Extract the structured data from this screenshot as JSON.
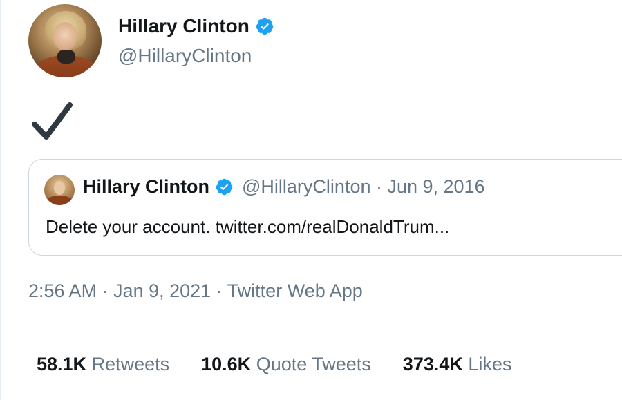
{
  "tweet": {
    "author": {
      "display_name": "Hillary Clinton",
      "handle": "@HillaryClinton",
      "verified_icon": "verified-badge-icon"
    },
    "body": {
      "icon": "check-mark-icon"
    },
    "quoted_tweet": {
      "display_name": "Hillary Clinton",
      "handle_and_date": "@HillaryClinton · Jun 9, 2016",
      "text": "Delete your account. twitter.com/realDonaldTrum..."
    },
    "timestamp": "2:56 AM · Jan 9, 2021 · Twitter Web App",
    "stats": [
      {
        "count": "58.1K",
        "label": "Retweets"
      },
      {
        "count": "10.6K",
        "label": "Quote Tweets"
      },
      {
        "count": "373.4K",
        "label": "Likes"
      }
    ]
  },
  "colors": {
    "verified": "#1da1f2",
    "secondary_text": "#657786",
    "primary_text": "#14171a",
    "border": "#ccd6dd"
  }
}
